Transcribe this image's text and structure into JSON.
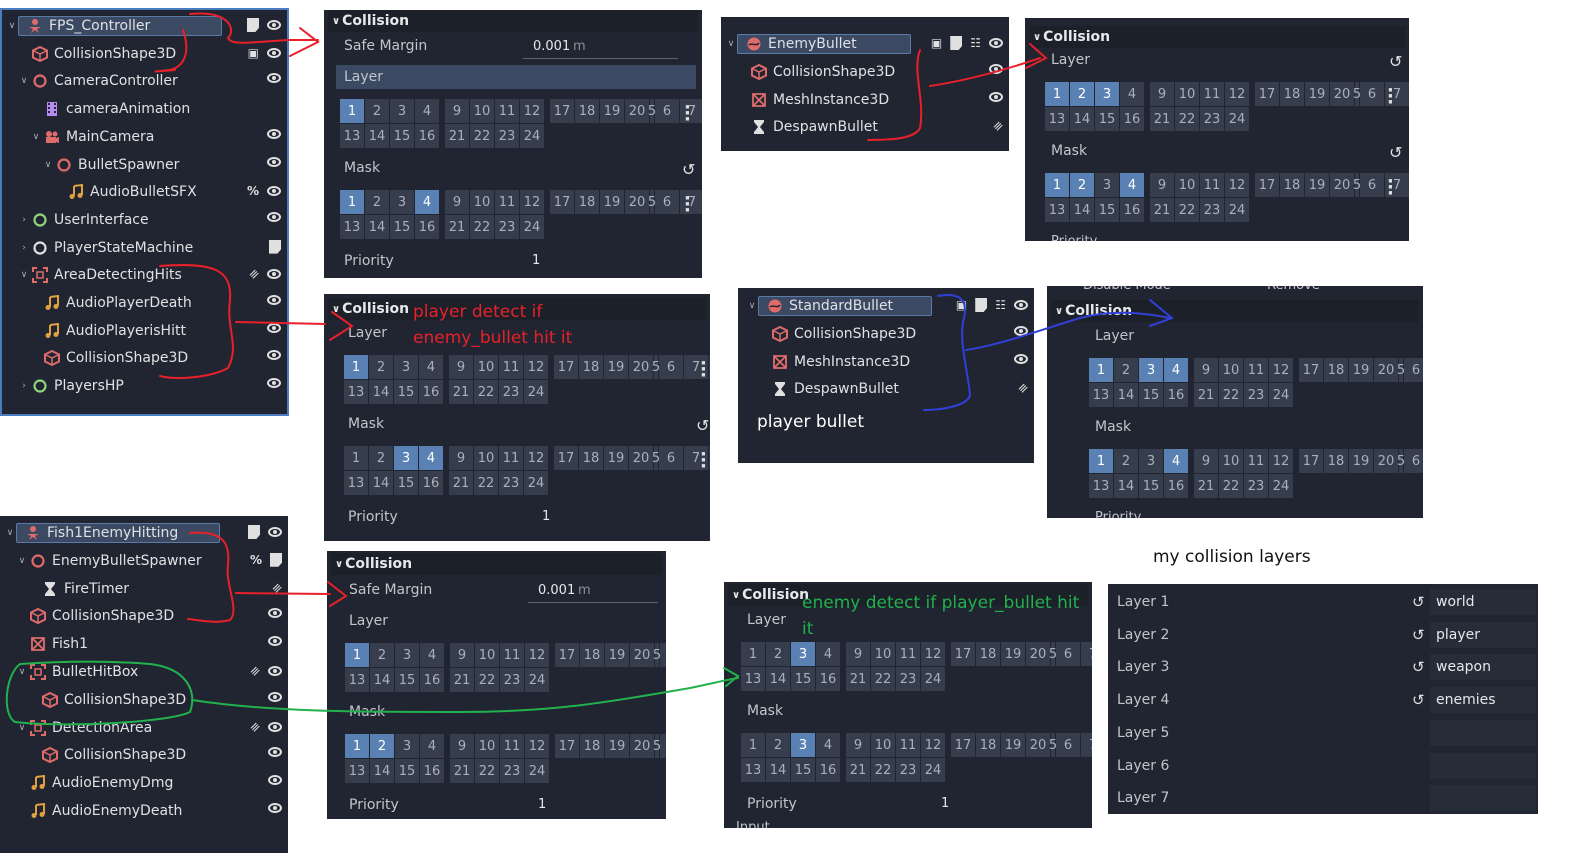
{
  "tree1": {
    "nodes": [
      {
        "label": "FPS_Controller",
        "indent": 0,
        "arrow": "v",
        "icon": "person",
        "color": "#e06b6b",
        "icons": [
          "scr",
          "eye"
        ],
        "sel": true
      },
      {
        "label": "CollisionShape3D",
        "indent": 1,
        "arrow": "",
        "icon": "cube",
        "color": "#e06b6b",
        "icons": [
          "pin",
          "eye"
        ]
      },
      {
        "label": "CameraController",
        "indent": 1,
        "arrow": "v",
        "icon": "ring",
        "color": "#e06b6b",
        "icons": [
          "eye"
        ]
      },
      {
        "label": "cameraAnimation",
        "indent": 2,
        "arrow": "",
        "icon": "film",
        "color": "#b68cf2",
        "icons": []
      },
      {
        "label": "MainCamera",
        "indent": 2,
        "arrow": "v",
        "icon": "cam",
        "color": "#e06b6b",
        "icons": [
          "eye"
        ]
      },
      {
        "label": "BulletSpawner",
        "indent": 3,
        "arrow": "v",
        "icon": "ring",
        "color": "#e06b6b",
        "icons": [
          "eye"
        ]
      },
      {
        "label": "AudioBulletSFX",
        "indent": 4,
        "arrow": "",
        "icon": "note",
        "color": "#e0a040",
        "icons": [
          "pct",
          "eye"
        ]
      },
      {
        "label": "UserInterface",
        "indent": 1,
        "arrow": ">",
        "icon": "ring",
        "color": "#8fd67a",
        "icons": [
          "eye"
        ]
      },
      {
        "label": "PlayerStateMachine",
        "indent": 1,
        "arrow": ">",
        "icon": "ring",
        "color": "#e0e0e0",
        "icons": [
          "scr"
        ]
      },
      {
        "label": "AreaDetectingHits",
        "indent": 1,
        "arrow": "v",
        "icon": "area",
        "color": "#e06b6b",
        "icons": [
          "sig",
          "eye"
        ]
      },
      {
        "label": "AudioPlayerDeath",
        "indent": 2,
        "arrow": "",
        "icon": "note",
        "color": "#e0a040",
        "icons": [
          "eye"
        ]
      },
      {
        "label": "AudioPlayerisHitt",
        "indent": 2,
        "arrow": "",
        "icon": "note",
        "color": "#e0a040",
        "icons": [
          "eye"
        ]
      },
      {
        "label": "CollisionShape3D",
        "indent": 2,
        "arrow": "",
        "icon": "cube",
        "color": "#e06b6b",
        "icons": [
          "eye"
        ]
      },
      {
        "label": "PlayersHP",
        "indent": 1,
        "arrow": ">",
        "icon": "ring",
        "color": "#8fd67a",
        "icons": [
          "eye"
        ]
      }
    ]
  },
  "tree2": {
    "nodes": [
      {
        "label": "Fish1EnemyHitting",
        "indent": 0,
        "arrow": "v",
        "icon": "person",
        "color": "#e06b6b",
        "icons": [
          "scr",
          "eye"
        ],
        "sel": true
      },
      {
        "label": "EnemyBulletSpawner",
        "indent": 1,
        "arrow": "v",
        "icon": "ring",
        "color": "#e06b6b",
        "icons": [
          "pct",
          "scr"
        ]
      },
      {
        "label": "FireTimer",
        "indent": 2,
        "arrow": "",
        "icon": "hourglass",
        "color": "#e0e0e0",
        "icons": [
          "sig"
        ]
      },
      {
        "label": "CollisionShape3D",
        "indent": 1,
        "arrow": "",
        "icon": "cube",
        "color": "#e06b6b",
        "icons": [
          "eye"
        ]
      },
      {
        "label": "Fish1",
        "indent": 1,
        "arrow": "",
        "icon": "mesh",
        "color": "#e06b6b",
        "icons": [
          "eye"
        ]
      },
      {
        "label": "BulletHitBox",
        "indent": 1,
        "arrow": "v",
        "icon": "area",
        "color": "#e06b6b",
        "icons": [
          "sig",
          "eye"
        ]
      },
      {
        "label": "CollisionShape3D",
        "indent": 2,
        "arrow": "",
        "icon": "cube",
        "color": "#e06b6b",
        "icons": [
          "eye"
        ]
      },
      {
        "label": "DetectionArea",
        "indent": 1,
        "arrow": "v",
        "icon": "area",
        "color": "#e06b6b",
        "icons": [
          "sig",
          "eye"
        ]
      },
      {
        "label": "CollisionShape3D",
        "indent": 2,
        "arrow": "",
        "icon": "cube",
        "color": "#e06b6b",
        "icons": [
          "eye"
        ]
      },
      {
        "label": "AudioEnemyDmg",
        "indent": 1,
        "arrow": "",
        "icon": "note",
        "color": "#e0a040",
        "icons": [
          "eye"
        ]
      },
      {
        "label": "AudioEnemyDeath",
        "indent": 1,
        "arrow": "",
        "icon": "note",
        "color": "#e0a040",
        "icons": [
          "eye"
        ]
      }
    ]
  },
  "enemy_bullet_tree": {
    "nodes": [
      {
        "label": "EnemyBullet",
        "indent": 0,
        "arrow": "v",
        "icon": "globe",
        "color": "#e06b6b",
        "icons": [
          "pin",
          "scr",
          "grid",
          "eye"
        ],
        "sel": true
      },
      {
        "label": "CollisionShape3D",
        "indent": 1,
        "arrow": "",
        "icon": "cube",
        "color": "#e06b6b",
        "icons": [
          "eye"
        ]
      },
      {
        "label": "MeshInstance3D",
        "indent": 1,
        "arrow": "",
        "icon": "mesh",
        "color": "#e06b6b",
        "icons": [
          "eye"
        ]
      },
      {
        "label": "DespawnBullet",
        "indent": 1,
        "arrow": "",
        "icon": "hourglass",
        "color": "#e0e0e0",
        "icons": [
          "sig"
        ]
      }
    ]
  },
  "standard_bullet_tree": {
    "nodes": [
      {
        "label": "StandardBullet",
        "indent": 0,
        "arrow": "v",
        "icon": "globe",
        "color": "#e06b6b",
        "icons": [
          "pin",
          "scr",
          "grid",
          "eye"
        ],
        "sel": true
      },
      {
        "label": "CollisionShape3D",
        "indent": 1,
        "arrow": "",
        "icon": "cube",
        "color": "#e06b6b",
        "icons": [
          "eye"
        ]
      },
      {
        "label": "MeshInstance3D",
        "indent": 1,
        "arrow": "",
        "icon": "mesh",
        "color": "#e06b6b",
        "icons": [
          "eye"
        ]
      },
      {
        "label": "DespawnBullet",
        "indent": 1,
        "arrow": "",
        "icon": "hourglass",
        "color": "#e0e0e0",
        "icons": [
          "sig"
        ]
      }
    ],
    "caption": "player bullet"
  },
  "collision_panels": {
    "p1": {
      "header": "Collision",
      "safe_margin_label": "Safe Margin",
      "safe_margin_value": "0.001",
      "unit": "m",
      "layer_label": "Layer",
      "mask_label": "Mask",
      "priority_label": "Priority",
      "priority_value": "1",
      "layer_on": [
        1
      ],
      "mask_on": [
        1,
        4
      ]
    },
    "p2": {
      "header": "Collision",
      "layer_label": "Layer",
      "mask_label": "Mask",
      "priority_label": "Priority",
      "priority_value": "1",
      "layer_on": [
        1
      ],
      "mask_on": [
        3,
        4
      ],
      "annotation": "player detect if\nenemy_bullet hit it"
    },
    "p3": {
      "header": "Collision",
      "safe_margin_label": "Safe Margin",
      "safe_margin_value": "0.001",
      "unit": "m",
      "layer_label": "Layer",
      "mask_label": "Mask",
      "priority_label": "Priority",
      "priority_value": "1",
      "layer_on": [
        1
      ],
      "mask_on": [
        1,
        2
      ]
    },
    "p4": {
      "header": "Collision",
      "layer_label": "Layer",
      "mask_label": "Mask",
      "layer_on": [
        1,
        2,
        3
      ],
      "mask_on": [
        1,
        2,
        4
      ],
      "cut_text": "Priority"
    },
    "p5": {
      "header": "Collision",
      "top_cut_left": "Disable Mode",
      "top_cut_right": "Remove",
      "layer_label": "Layer",
      "mask_label": "Mask",
      "layer_on": [
        1,
        3,
        4
      ],
      "mask_on": [
        1,
        4
      ],
      "cut_text": "Priority"
    },
    "p6": {
      "header": "Collision",
      "layer_label": "Layer",
      "mask_label": "Mask",
      "priority_label": "Priority",
      "priority_value": "1",
      "layer_on": [
        3
      ],
      "mask_on": [
        3
      ],
      "annotation": "enemy detect if player_bullet hit it",
      "bottom_cut": "Input"
    }
  },
  "collision_layers": {
    "title": "my collision layers",
    "rows": [
      {
        "label": "Layer 1",
        "name": "world"
      },
      {
        "label": "Layer 2",
        "name": "player"
      },
      {
        "label": "Layer 3",
        "name": "weapon"
      },
      {
        "label": "Layer 4",
        "name": "enemies"
      },
      {
        "label": "Layer 5",
        "name": ""
      },
      {
        "label": "Layer 6",
        "name": ""
      },
      {
        "label": "Layer 7",
        "name": ""
      }
    ]
  },
  "colors": {
    "panel_bg": "#202531",
    "bit_on": "#5981b3",
    "bit_off": "#363e4d",
    "red_annot": "#e8202a",
    "green_annot": "#22b14c",
    "blue_annot": "#3040d8"
  }
}
